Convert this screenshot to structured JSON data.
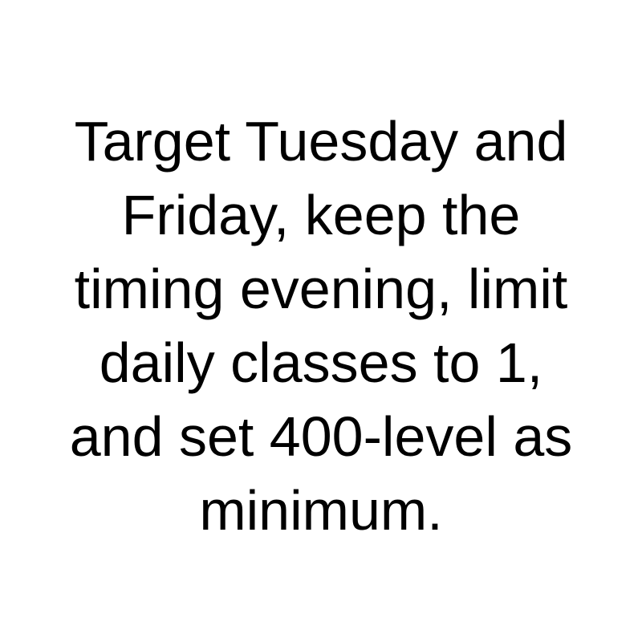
{
  "instruction": {
    "lines": [
      "Target Tuesday and",
      "Friday, keep the",
      "timing evening, limit",
      "daily classes to 1,",
      "and set 400-level as",
      "minimum."
    ]
  }
}
